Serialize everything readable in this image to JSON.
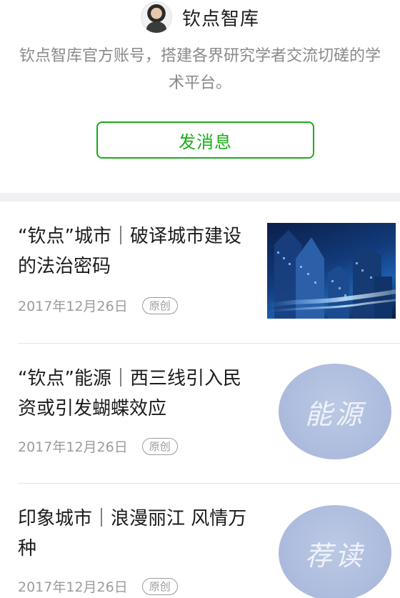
{
  "account": {
    "name": "钦点智库",
    "description": "钦点智库官方账号，搭建各界研究学者交流切磋的学术平台。",
    "message_button": "发消息"
  },
  "articles": [
    {
      "title": "“钦点”城市｜破译城市建设的法治密码",
      "date": "2017年12月26日",
      "tag": "原创",
      "thumbnail": "city-night-skyline"
    },
    {
      "title": "“钦点”能源｜西三线引入民资或引发蝴蝶效应",
      "date": "2017年12月26日",
      "tag": "原创",
      "thumbnail_text": "能源"
    },
    {
      "title": "印象城市｜浪漫丽江 风情万种",
      "date": "2017年12月26日",
      "tag": "原创",
      "thumbnail_text": "荐读"
    }
  ]
}
